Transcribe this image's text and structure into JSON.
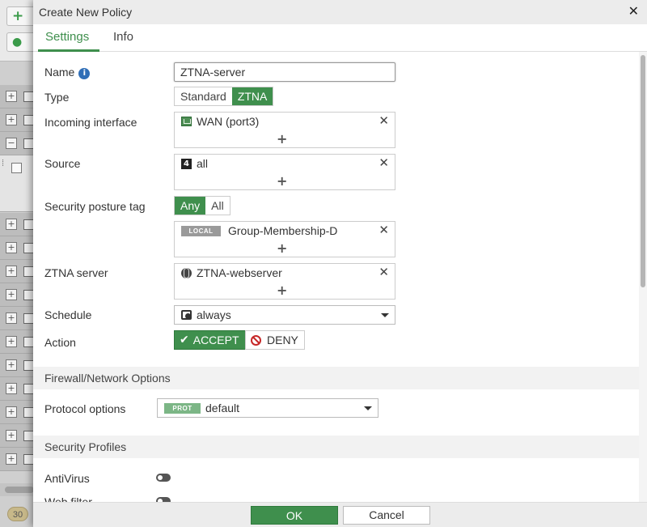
{
  "background": {
    "badge_count": "30"
  },
  "dialog": {
    "title": "Create New Policy",
    "close_icon": "close-icon"
  },
  "tabs": [
    {
      "label": "Settings"
    },
    {
      "label": "Info"
    }
  ],
  "form": {
    "name": {
      "label": "Name",
      "value": "ZTNA-server"
    },
    "type": {
      "label": "Type",
      "options": [
        "Standard",
        "ZTNA"
      ],
      "selected": "ZTNA"
    },
    "incoming_interface": {
      "label": "Incoming interface",
      "entry": "WAN (port3)"
    },
    "source": {
      "label": "Source",
      "entry": "all"
    },
    "security_posture_tag": {
      "label": "Security posture tag",
      "options": [
        "Any",
        "All"
      ],
      "selected": "Any",
      "tag_badge": "LOCAL",
      "entry": "Group-Membership-D"
    },
    "ztna_server": {
      "label": "ZTNA server",
      "entry": "ZTNA-webserver"
    },
    "schedule": {
      "label": "Schedule",
      "value": "always"
    },
    "action": {
      "label": "Action",
      "accept": "ACCEPT",
      "deny": "DENY",
      "selected": "ACCEPT"
    }
  },
  "firewall_section": {
    "title": "Firewall/Network Options",
    "protocol_options": {
      "label": "Protocol options",
      "badge": "PROT",
      "value": "default"
    }
  },
  "security_profiles": {
    "title": "Security Profiles",
    "antivirus": {
      "label": "AntiVirus",
      "enabled": false
    },
    "webfilter": {
      "label": "Web filter",
      "enabled": false
    }
  },
  "footer": {
    "ok": "OK",
    "cancel": "Cancel"
  },
  "colors": {
    "accent": "#3f8f4d",
    "deny": "#c62828",
    "info": "#2f6eb7"
  }
}
